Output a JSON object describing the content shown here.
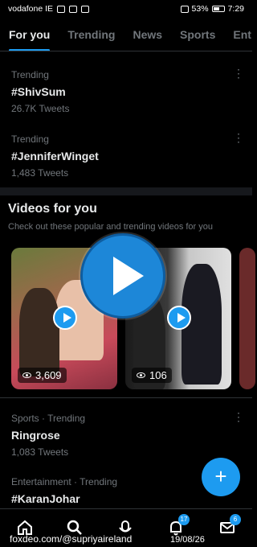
{
  "status_bar": {
    "carrier": "vodafone IE",
    "battery": "53%",
    "time": "7:29"
  },
  "tabs": [
    "For you",
    "Trending",
    "News",
    "Sports",
    "Ent"
  ],
  "trends_top": [
    {
      "meta": "Trending",
      "name": "#ShivSum",
      "count": "26.7K Tweets"
    },
    {
      "meta": "Trending",
      "name": "#JenniferWinget",
      "count": "1,483 Tweets"
    }
  ],
  "videos": {
    "title": "Videos for you",
    "subtitle": "Check out these popular and trending videos for you",
    "cards": [
      {
        "views": "3,609"
      },
      {
        "views": "106"
      }
    ]
  },
  "trends_bottom": [
    {
      "meta": "Sports · Trending",
      "name": "Ringrose",
      "count": "1,083 Tweets"
    },
    {
      "meta": "Entertainment · Trending",
      "name": "#KaranJohar",
      "count": ""
    }
  ],
  "fab": {
    "label": "+"
  },
  "bottom_nav": {
    "notifications_badge": "17",
    "messages_badge": "6"
  },
  "watermark": {
    "left": "foxdeo.com/@supriyaireland",
    "right": "19/08/26"
  },
  "colors": {
    "accent": "#1d9bf0",
    "background": "#000000",
    "muted": "#71767b"
  }
}
